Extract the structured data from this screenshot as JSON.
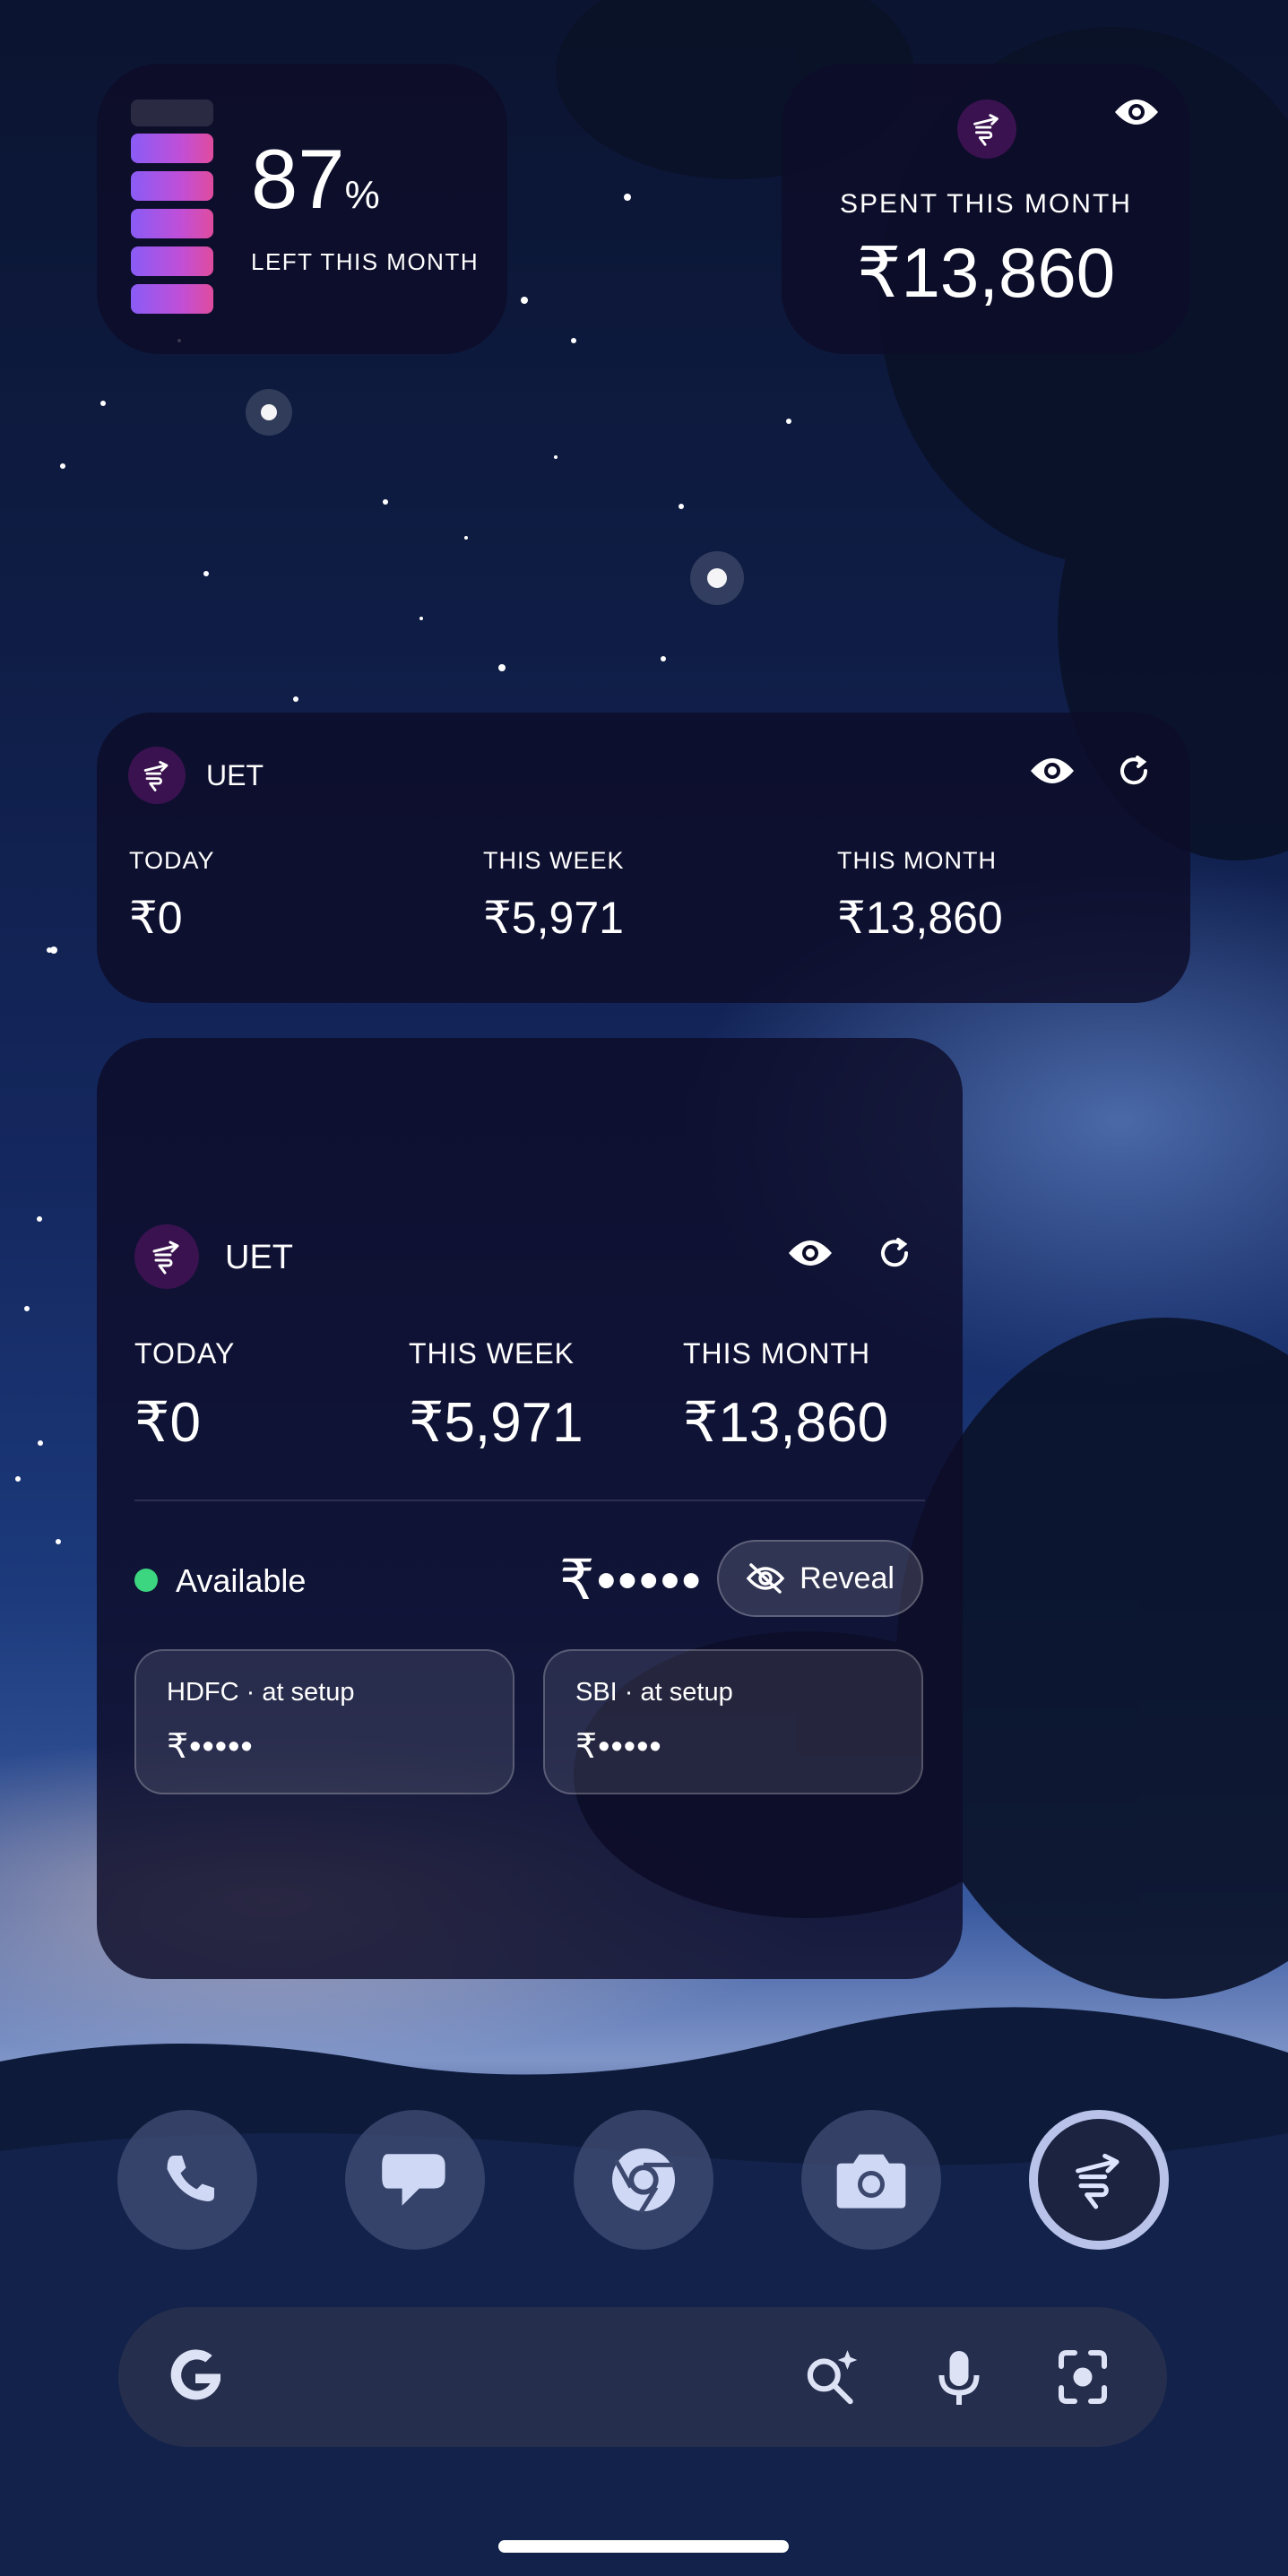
{
  "battery_widget": {
    "percent": "87",
    "percent_sign": "%",
    "label": "LEFT THIS MONTH",
    "segments_filled": 5
  },
  "spent_widget": {
    "label": "SPENT THIS MONTH",
    "value": "₹13,860"
  },
  "medium_widget": {
    "app_name": "UET",
    "today_label": "TODAY",
    "today_value": "₹0",
    "week_label": "THIS WEEK",
    "week_value": "₹5,971",
    "month_label": "THIS MONTH",
    "month_value": "₹13,860"
  },
  "large_widget": {
    "app_name": "UET",
    "today_label": "TODAY",
    "today_value": "₹0",
    "week_label": "THIS WEEK",
    "week_value": "₹5,971",
    "month_label": "THIS MONTH",
    "month_value": "₹13,860",
    "status": "Available",
    "available_masked": "₹•••••",
    "reveal_label": "Reveal",
    "accounts": [
      {
        "name": "HDFC · at setup",
        "balance": "₹•••••"
      },
      {
        "name": "SBI · at setup",
        "balance": "₹•••••"
      }
    ]
  },
  "dock": [
    "phone-icon",
    "messages-icon",
    "chrome-icon",
    "camera-icon",
    "uet-app-icon"
  ],
  "search": {
    "icons": [
      "google-g-icon",
      "ai-mode-icon",
      "mic-icon",
      "lens-icon"
    ]
  },
  "colors": {
    "widget_bg": "#0d0c28",
    "accent_purple": "#8a5cf6",
    "accent_pink": "#e04c9e",
    "available_green": "#3bd67f"
  }
}
